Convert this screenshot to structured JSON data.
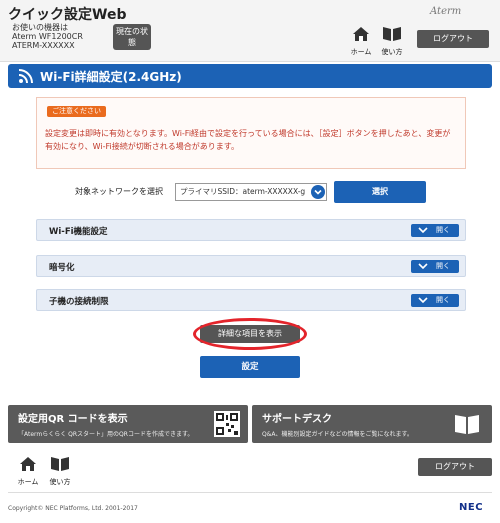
{
  "header": {
    "app_title": "クイック設定Web",
    "model_label": "お使いの機器は",
    "model_name": "Aterm WF1200CR",
    "model_ssid": "ATERM-XXXXXX",
    "status_button": "現在の状態",
    "brand": "Aterm",
    "home_label": "ホーム",
    "manual_label": "使い方",
    "logout_label": "ログアウト"
  },
  "page": {
    "title": "Wi-Fi詳細設定(2.4GHz)"
  },
  "notice": {
    "badge": "ご注意ください",
    "text": "設定変更は即時に有効となります。Wi-Fi経由で設定を行っている場合には、［設定］ボタンを押したあと、変更が有効になり、Wi-Fi接続が切断される場合があります。"
  },
  "network": {
    "label": "対象ネットワークを選択",
    "selected": "プライマリSSID：aterm-XXXXXX-g",
    "select_button": "選択"
  },
  "sections": [
    {
      "label": "Wi-Fi機能設定",
      "open": "開く"
    },
    {
      "label": "暗号化",
      "open": "開く"
    },
    {
      "label": "子機の接続制限",
      "open": "開く"
    }
  ],
  "actions": {
    "detail_button": "詳細な項目を表示",
    "submit_button": "設定"
  },
  "cards": {
    "qr_title": "設定用QR コードを表示",
    "qr_desc": "「Atermらくらく QRスタート」用のQRコードを作成できます。",
    "support_title": "サポートデスク",
    "support_desc": "Q&A、機能別設定ガイドなどの情報をご覧になれます。"
  },
  "footer": {
    "home_label": "ホーム",
    "manual_label": "使い方",
    "logout_label": "ログアウト",
    "copyright": "Copyright© NEC Platforms, Ltd. 2001-2017",
    "logo": "NEC"
  },
  "colors": {
    "primary": "#1c62b5",
    "dark_button": "#555555",
    "notice_text": "#c0392b",
    "notice_badge": "#ea6b1e",
    "highlight_ring": "#e3242b"
  }
}
